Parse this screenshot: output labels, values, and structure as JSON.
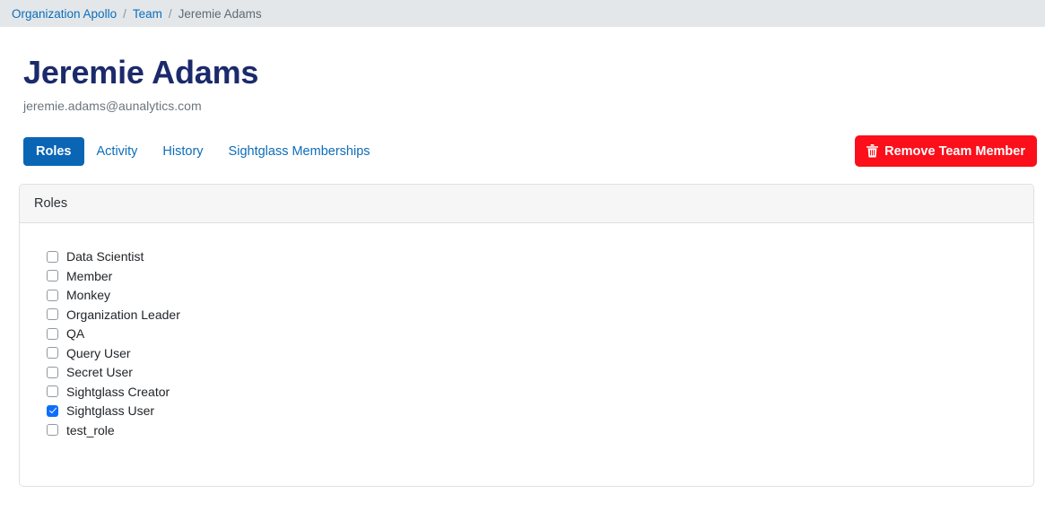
{
  "breadcrumb": {
    "items": [
      {
        "label": "Organization Apollo",
        "current": false
      },
      {
        "label": "Team",
        "current": false
      },
      {
        "label": "Jeremie Adams",
        "current": true
      }
    ],
    "separator": "/"
  },
  "header": {
    "title": "Jeremie Adams",
    "email": "jeremie.adams@aunalytics.com"
  },
  "tabs": [
    {
      "label": "Roles",
      "active": true
    },
    {
      "label": "Activity",
      "active": false
    },
    {
      "label": "History",
      "active": false
    },
    {
      "label": "Sightglass Memberships",
      "active": false
    }
  ],
  "actions": {
    "remove_label": "Remove Team Member",
    "remove_icon": "trash-icon"
  },
  "roles_card": {
    "title": "Roles",
    "roles": [
      {
        "label": "Data Scientist",
        "checked": false
      },
      {
        "label": "Member",
        "checked": false
      },
      {
        "label": "Monkey",
        "checked": false
      },
      {
        "label": "Organization Leader",
        "checked": false
      },
      {
        "label": "QA",
        "checked": false
      },
      {
        "label": "Query User",
        "checked": false
      },
      {
        "label": "Secret User",
        "checked": false
      },
      {
        "label": "Sightglass Creator",
        "checked": false
      },
      {
        "label": "Sightglass User",
        "checked": true
      },
      {
        "label": "test_role",
        "checked": false
      }
    ]
  },
  "colors": {
    "breadcrumb_bg": "#e3e7ea",
    "link_blue": "#0d6db8",
    "active_tab_bg": "#0a66b5",
    "title_navy": "#1b2a6b",
    "danger_red": "#fa0f1b",
    "checkbox_blue": "#0d6efd",
    "card_header_bg": "#f6f6f7"
  }
}
